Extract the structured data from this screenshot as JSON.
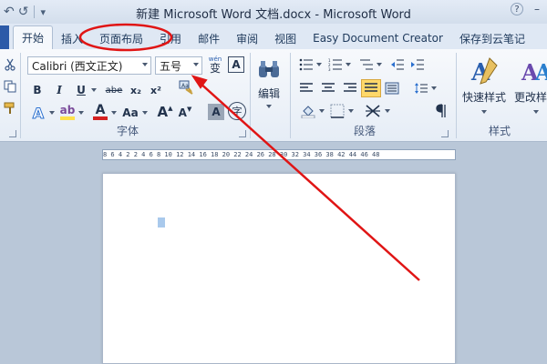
{
  "window": {
    "title": "新建 Microsoft Word 文档.docx - Microsoft Word"
  },
  "quick_access": {
    "undo_icon": "↶",
    "redo_icon": "↺",
    "customize_icon": "▾"
  },
  "window_controls": {
    "help": "?",
    "minimize": "–"
  },
  "tabs": [
    {
      "label": "开始",
      "active": true
    },
    {
      "label": "插入"
    },
    {
      "label": "页面布局"
    },
    {
      "label": "引用"
    },
    {
      "label": "邮件"
    },
    {
      "label": "审阅"
    },
    {
      "label": "视图"
    },
    {
      "label": "Easy Document Creator"
    },
    {
      "label": "保存到云笔记"
    }
  ],
  "font_group": {
    "label": "字体",
    "font_name": "Calibri (西文正文)",
    "font_size": "五号",
    "wen_label": "wén",
    "wen_char": "变",
    "border_char": "A",
    "bold": "B",
    "italic": "I",
    "underline": "U",
    "strike": "abe",
    "subscript": "x₂",
    "superscript": "x²",
    "grow": "A",
    "shrink": "A",
    "case": "Aa",
    "shade": "A",
    "circle": "字"
  },
  "editing": {
    "label": "编辑"
  },
  "paragraph_group": {
    "label": "段落"
  },
  "styles_group": {
    "label": "样式",
    "quick_styles": "快速样式",
    "change_styles": "更改样式"
  },
  "ruler": {
    "text": "8 6 4 2  2 4 6 8 10 12 14 16 18 20 22 24 26 28 30 32 34 36 38  42 44 46 48"
  },
  "colors": {
    "annotation": "#e01515",
    "file_tab": "#2c5aa8",
    "highlight": "#ffe04a",
    "font_color": "#d42020"
  }
}
